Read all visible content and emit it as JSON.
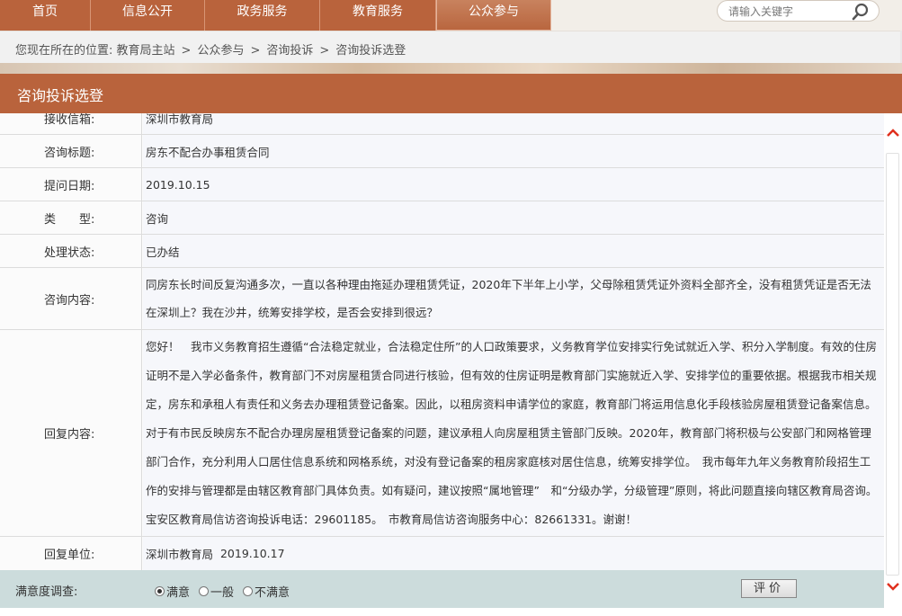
{
  "nav": {
    "items": [
      {
        "label": "首页"
      },
      {
        "label": "信息公开"
      },
      {
        "label": "政务服务"
      },
      {
        "label": "教育服务"
      },
      {
        "label": "公众参与",
        "active": true
      }
    ]
  },
  "search": {
    "placeholder": "请输入关键字",
    "icon": "search-icon"
  },
  "breadcrumb": {
    "prefix": "您现在所在的位置: ",
    "items": [
      "教育局主站",
      "咨询投诉",
      "咨询投诉选登"
    ],
    "first": "教育局主站",
    "second": "公众参与",
    "third": "咨询投诉",
    "fourth": "咨询投诉选登",
    "separator": ">"
  },
  "section": {
    "title": "咨询投诉选登"
  },
  "detail": {
    "receiver_label": "接收信箱:",
    "receiver_value": "深圳市教育局",
    "subject_label": "咨询标题:",
    "subject_value": "房东不配合办事租赁合同",
    "date_label": "提问日期:",
    "date_value": "2019.10.15",
    "type_label": "类　　型:",
    "type_value": "咨询",
    "status_label": "处理状态:",
    "status_value": "已办结",
    "content_label": "咨询内容:",
    "content_value": "同房东长时间反复沟通多次，一直以各种理由拖延办理租赁凭证，2020年下半年上小学，父母除租赁凭证外资料全部齐全，没有租赁凭证是否无法在深圳上？我在沙井，统筹安排学校，是否会安排到很远？",
    "reply_label": "回复内容:",
    "reply_value": "您好！　我市义务教育招生遵循“合法稳定就业，合法稳定住所”的人口政策要求，义务教育学位安排实行免试就近入学、积分入学制度。有效的住房证明不是入学必备条件，教育部门不对房屋租赁合同进行核验，但有效的住房证明是教育部门实施就近入学、安排学位的重要依据。根据我市相关规定，房东和承租人有责任和义务去办理租赁登记备案。因此，以租房资料申请学位的家庭，教育部门将运用信息化手段核验房屋租赁登记备案信息。对于有市民反映房东不配合办理房屋租赁登记备案的问题，建议承租人向房屋租赁主管部门反映。2020年，教育部门将积极与公安部门和网格管理部门合作，充分利用人口居住信息系统和网格系统，对没有登记备案的租房家庭核对居住信息，统筹安排学位。　我市每年九年义务教育阶段招生工作的安排与管理都是由辖区教育部门具体负责。如有疑问，建议按照“属地管理”　和“分级办学，分级管理”原则，将此问题直接向辖区教育局咨询。宝安区教育局信访咨询投诉电话：29601185。　市教育局信访咨询服务中心：82661331。谢谢！",
    "unit_label": "回复单位:",
    "unit_value": "深圳市教育局",
    "unit_date": "2019.10.17"
  },
  "satisfaction": {
    "label": "满意度调查:",
    "options": [
      "满意",
      "一般",
      "不满意"
    ],
    "selected": "满意",
    "button": "评价"
  },
  "colors": {
    "brand": "#b9633c",
    "row_value_bg": "#f6f7fb",
    "satisfaction_bg": "#ccdcdc",
    "scroll_arrow": "#e0301e"
  }
}
